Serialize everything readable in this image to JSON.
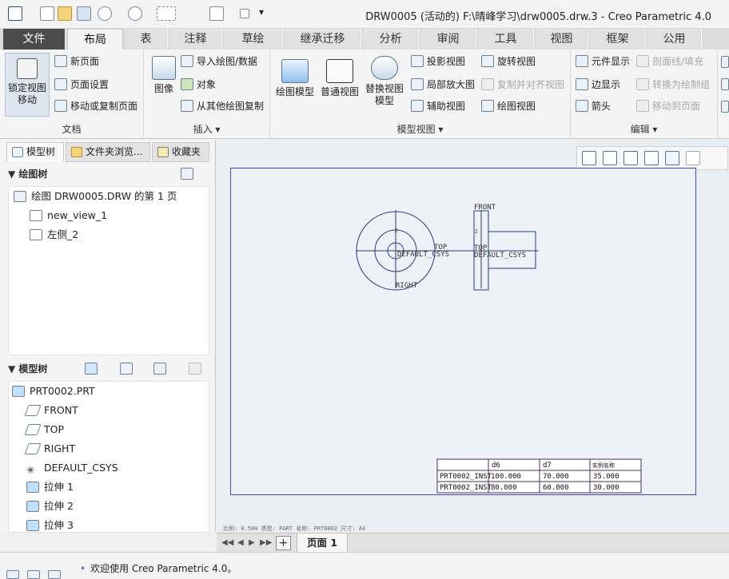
{
  "window": {
    "title": "DRW0005 (活动的) F:\\晴峰学习\\drw0005.drw.3 - Creo Parametric 4.0"
  },
  "menu": {
    "tabs": [
      "文件",
      "布局",
      "表",
      "注释",
      "草绘",
      "继承迁移",
      "分析",
      "审阅",
      "工具",
      "视图",
      "框架",
      "公用"
    ],
    "active": "布局"
  },
  "ribbon": {
    "doc_group": {
      "label": "文档",
      "lock_view": "锁定视图\n移动",
      "new_page": "新页面",
      "page_setup": "页面设置",
      "move_copy_page": "移动或复制页面"
    },
    "insert_group": {
      "label": "插入 ▾",
      "image": "图像",
      "import_drawing": "导入绘图/数据",
      "object": "对象",
      "copy_from_other": "从其他绘图复制"
    },
    "model_view_group": {
      "label": "模型视图 ▾",
      "drawing_model": "绘图模型",
      "general_view": "普通视图",
      "replace_view": "替换视图\n模型",
      "projection_view": "投影视图",
      "detail_view": "局部放大图",
      "auxiliary_view": "辅助视图",
      "revolve_view": "旋转视图",
      "copy_align_view": "复制并对齐视图",
      "drawing_view": "绘图视图"
    },
    "edit_group": {
      "label": "编辑 ▾",
      "component_display": "元件显示",
      "edge_display": "边显示",
      "arrow": "箭头",
      "section_line": "剖面线/填充",
      "convert_to_group": "转换为绘制组",
      "move_to_page": "移动到页面"
    }
  },
  "panel": {
    "tabs": [
      "模型树",
      "文件夹浏览...",
      "收藏夹"
    ],
    "drawing_tree_title": "绘图树",
    "drawing_tree": [
      "绘图 DRW0005.DRW 的第 1 页",
      "new_view_1",
      "左侧_2"
    ],
    "model_tree_title": "模型树",
    "model_tree": [
      "PRT0002.PRT",
      "FRONT",
      "TOP",
      "RIGHT",
      "DEFAULT_CSYS",
      "拉伸 1",
      "拉伸 2",
      "拉伸 3"
    ]
  },
  "drawing": {
    "front_view_labels": {
      "top": "TOP",
      "csys": "DEFAULT_CSYS",
      "right": "RIGHT",
      "z": "Z"
    },
    "side_view_labels": {
      "front": "FRONT",
      "top": "TOP",
      "csys": "DEFAULT_CSYS",
      "z": "Z"
    },
    "table": {
      "headers": [
        "",
        "d6",
        "d7",
        "实例名称"
      ],
      "rows": [
        [
          "PRT0002_INST",
          "100.000",
          "70.000",
          "35.000"
        ],
        [
          "PRT0002_INST",
          "80.000",
          "60.000",
          "30.000"
        ]
      ]
    },
    "scale_line": "比例: 0.500   类型: PART   名称: PRT0002   尺寸: A4"
  },
  "pagebar": {
    "page_label": "页面 1",
    "add": "+"
  },
  "status": {
    "message": "欢迎使用 Creo Parametric 4.0。"
  }
}
